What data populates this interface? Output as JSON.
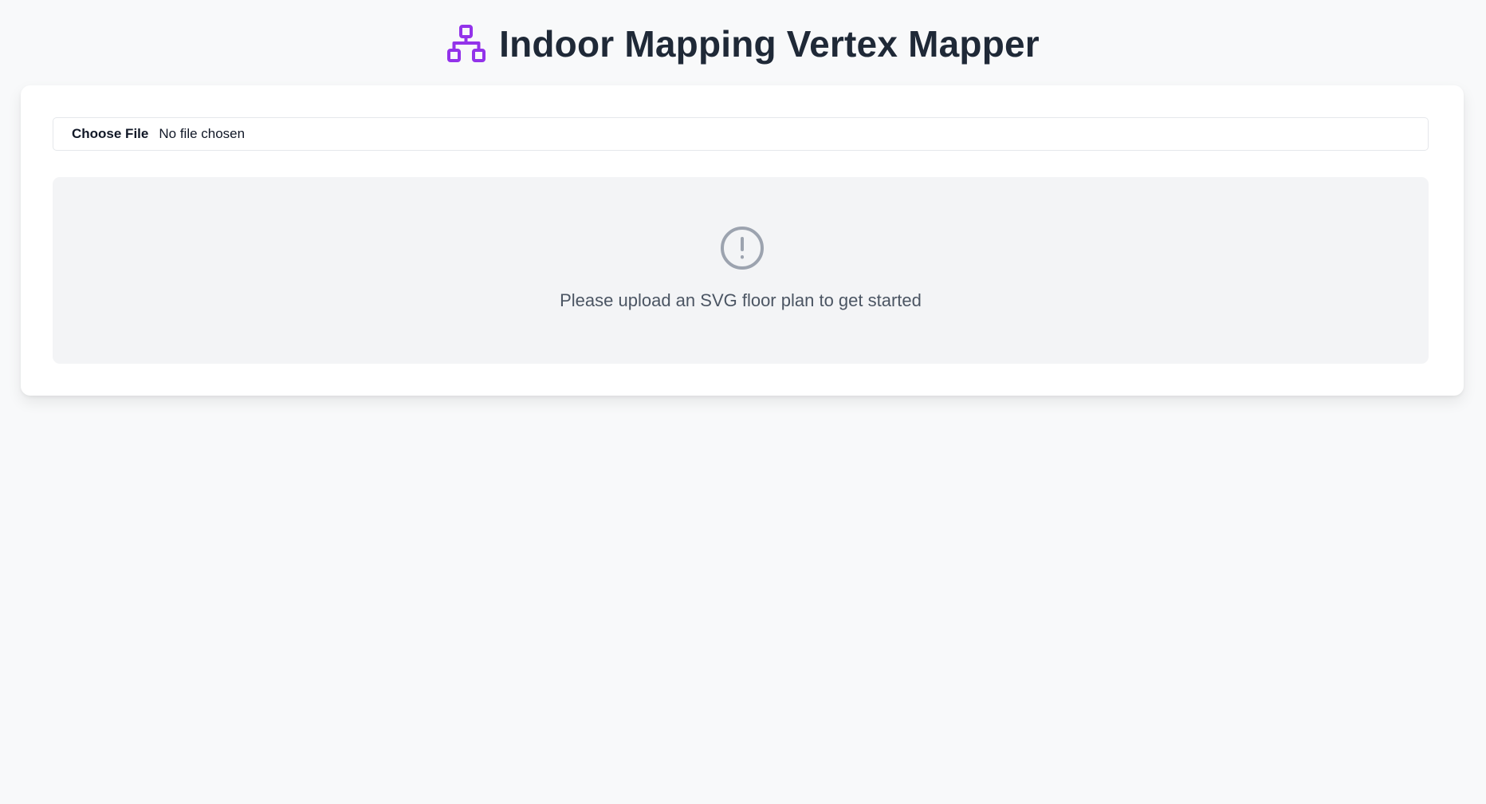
{
  "app": {
    "title": "Indoor Mapping Vertex Mapper",
    "logo_icon": "network-icon",
    "accent_color": "#9333ea"
  },
  "upload": {
    "button_label": "Choose File",
    "status": "No file chosen"
  },
  "empty_state": {
    "icon": "alert-circle-icon",
    "message": "Please upload an SVG floor plan to get started"
  }
}
